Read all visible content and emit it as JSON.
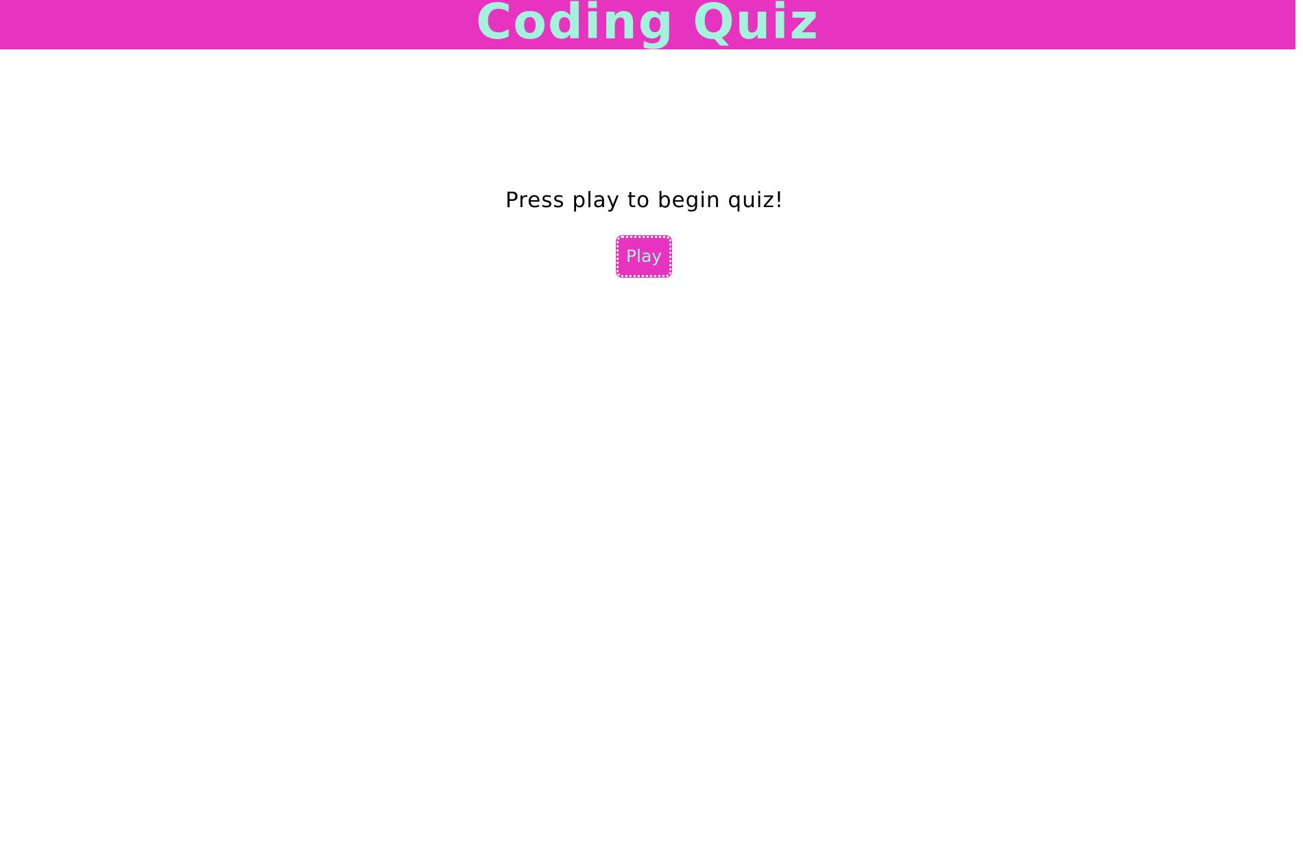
{
  "header": {
    "title": "Coding Quiz"
  },
  "main": {
    "prompt": "Press play to begin quiz!",
    "play_label": "Play"
  },
  "colors": {
    "accent": "#e633c0",
    "title_text": "#a5f2dc",
    "body_text": "#000000",
    "background": "#ffffff"
  }
}
